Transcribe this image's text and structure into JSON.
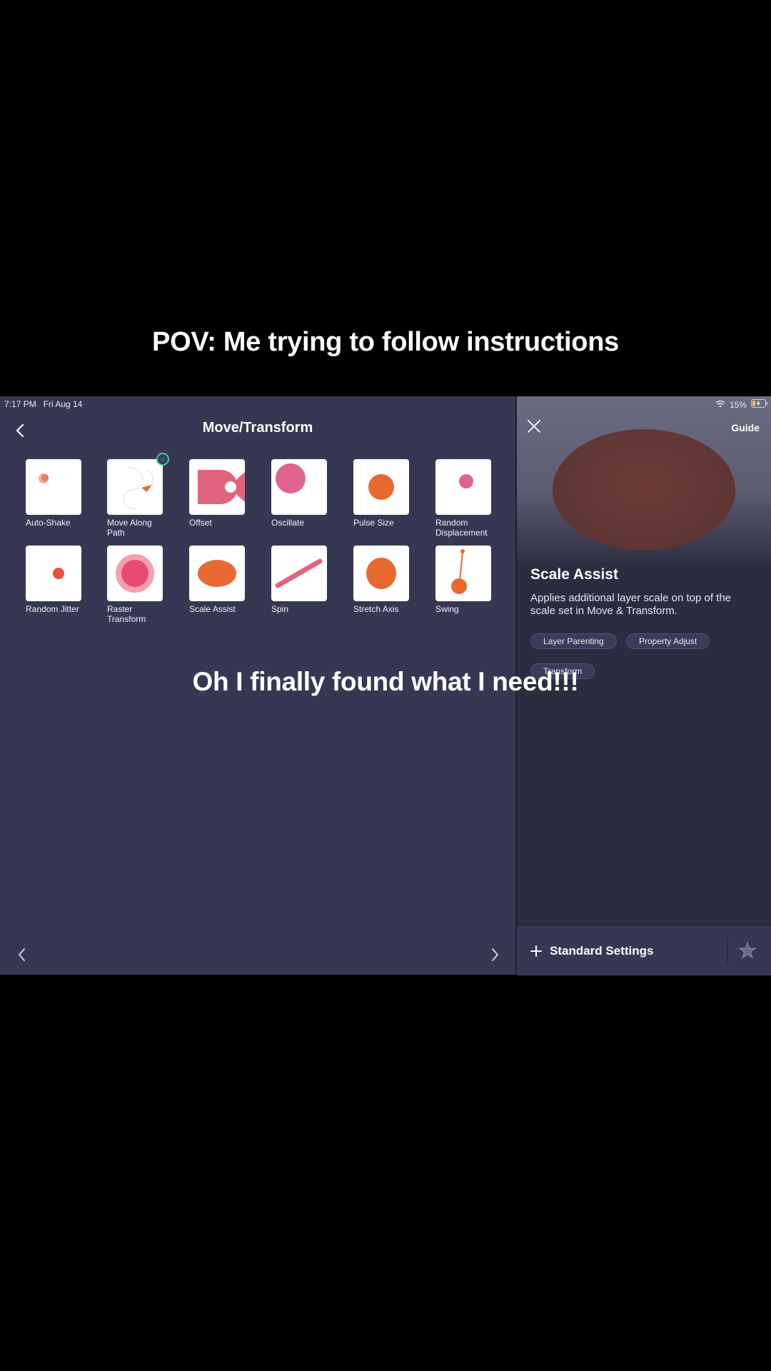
{
  "captions": {
    "top": "POV: Me trying to follow instructions",
    "middle": "Oh I finally found what I need!!!"
  },
  "status_bar": {
    "time": "7:17 PM",
    "date": "Fri Aug 14",
    "battery": "15%"
  },
  "left_panel": {
    "title": "Move/Transform",
    "tiles": [
      {
        "label": "Auto-Shake",
        "icon": "auto-shake-icon"
      },
      {
        "label": "Move Along Path",
        "icon": "move-along-path-icon"
      },
      {
        "label": "Offset",
        "icon": "offset-icon"
      },
      {
        "label": "Oscillate",
        "icon": "oscillate-icon"
      },
      {
        "label": "Pulse Size",
        "icon": "pulse-size-icon"
      },
      {
        "label": "Random Displacement",
        "icon": "random-displacement-icon"
      },
      {
        "label": "Random Jitter",
        "icon": "random-jitter-icon"
      },
      {
        "label": "Raster Transform",
        "icon": "raster-transform-icon"
      },
      {
        "label": "Scale Assist",
        "icon": "scale-assist-icon"
      },
      {
        "label": "Spin",
        "icon": "spin-icon"
      },
      {
        "label": "Stretch Axis",
        "icon": "stretch-axis-icon"
      },
      {
        "label": "Swing",
        "icon": "swing-icon"
      }
    ]
  },
  "right_panel": {
    "guide_label": "Guide",
    "title": "Scale Assist",
    "description": "Applies additional layer scale on top of the scale set in Move & Transform.",
    "tags": [
      "Layer Parenting",
      "Property Adjust",
      "Transform"
    ],
    "footer_label": "Standard Settings"
  },
  "colors": {
    "panel": "#363853",
    "detail_bg": "#2b2c3f",
    "accent_orange": "#e8692f",
    "accent_pink": "#e0648c",
    "badge": "#3fc9a4"
  }
}
